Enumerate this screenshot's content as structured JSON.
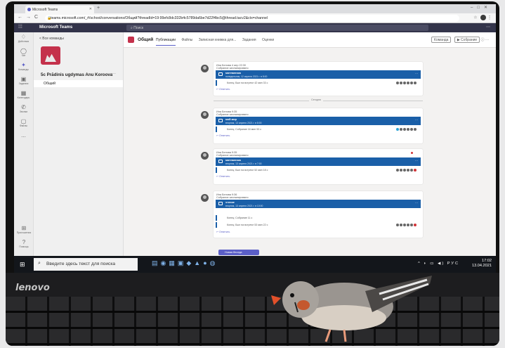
{
  "browser": {
    "tab_title": "Microsoft Teams",
    "url": "teams.microsoft.com/_#/school/conversations/Общий?threadId=19:99efc8dc332b4c5789da6be7d22f4bc5@thread.tacv2&ctx=channel"
  },
  "teams": {
    "app_name": "Microsoft Teams",
    "search_placeholder": "Поиск",
    "rail": [
      {
        "icon": "bell-icon",
        "label": "Действия"
      },
      {
        "icon": "chat-icon",
        "label": "Чат"
      },
      {
        "icon": "teams-icon",
        "label": "Команды"
      },
      {
        "icon": "assignments-icon",
        "label": "Задания"
      },
      {
        "icon": "calendar-icon",
        "label": "Календарь"
      },
      {
        "icon": "calls-icon",
        "label": "Звонки"
      },
      {
        "icon": "files-icon",
        "label": "Файлы"
      },
      {
        "icon": "more-icon",
        "label": "..."
      }
    ],
    "rail_bottom": [
      {
        "icon": "apps-icon",
        "label": "Приложения"
      },
      {
        "icon": "help-icon",
        "label": "Помощь"
      }
    ]
  },
  "team_panel": {
    "all_teams": "< Все команды",
    "team_name": "5c Prādinis ugdymas Anu Koroova",
    "channel": "Общий"
  },
  "channel_header": {
    "name": "Общий",
    "tabs": [
      "Публикации",
      "Файлы",
      "Записная книжка для...",
      "Задания",
      "Оценки"
    ],
    "meet_label": "Собрание",
    "team_label": "Команда"
  },
  "posts": [
    {
      "author": "Ина Белова  4 апр 22:30",
      "caption": "Собрание запланировано",
      "title": "математика",
      "date": "понедельник, 12 апреля 2021 г. в 8:00",
      "meeting": "Конец: Был на встрече 42 мин 33 с",
      "reply": "↩ Ответить",
      "top": "8"
    },
    {
      "author": "Ина Белова  9:35",
      "caption": "Собрание запланировано",
      "title": "мой мир",
      "date": "вторник, 13 апреля 2021 г. в 8:00",
      "meeting": "Конец: Собрание 16 мин 53 с",
      "reply": "↩ Ответить",
      "top": "78"
    },
    {
      "author": "Ина Белова  9:35",
      "caption": "Собрание запланировано",
      "title": "математика",
      "date": "вторник, 13 апреля 2021 г. в 7:00",
      "meeting": "Конец: Был на встрече 52 мин 18 с",
      "reply": "↩ Ответить",
      "top": "140"
    },
    {
      "author": "Ина Белова  9:36",
      "caption": "Собрание запланировано",
      "title": "чтение",
      "date": "вторник, 13 апреля 2021 г. в 10:00",
      "meeting": "Конец: Был на встрече 53 мин 22 с",
      "meeting2": "Конец: Собрание 11 с",
      "reply": "↩ Ответить",
      "top": "202"
    }
  ],
  "divider_label": "Сегодня",
  "new_conversation": "Новая беседа",
  "taskbar": {
    "search_placeholder": "Введите здесь текст для поиска",
    "tray_lang": "РУС",
    "time": "17:02",
    "date": "13.04.2021"
  },
  "laptop_brand": "lenovo"
}
